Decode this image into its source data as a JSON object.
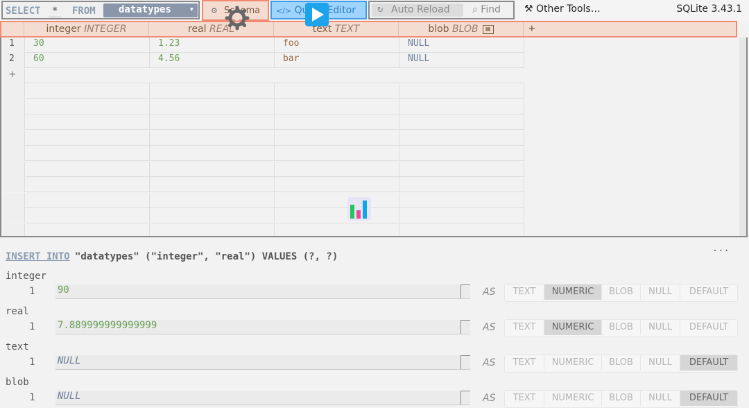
{
  "toolbar": {
    "select_kw": "SELECT",
    "star": "*",
    "from_kw": "FROM",
    "table_value": "datatypes",
    "schema_label": "Schema",
    "query_editor_label": "Query Editor",
    "auto_reload_label": "Auto Reload",
    "find_label": "Find",
    "other_tools_label": "Other Tools…",
    "version": "SQLite 3.43.1"
  },
  "columns": [
    {
      "name": "integer",
      "type": "INTEGER"
    },
    {
      "name": "real",
      "type": "REAL"
    },
    {
      "name": "text",
      "type": "TEXT"
    },
    {
      "name": "blob",
      "type": "BLOB"
    }
  ],
  "add_column_label": "+",
  "rows": [
    {
      "n": "1",
      "integer": "30",
      "real": "1.23",
      "text": "foo",
      "blob": "NULL"
    },
    {
      "n": "2",
      "integer": "60",
      "real": "4.56",
      "text": "bar",
      "blob": "NULL"
    }
  ],
  "add_row_label": "+",
  "insert": {
    "keyword": "INSERT INTO",
    "statement": "\"datatypes\" (\"integer\", \"real\") VALUES (?, ?)",
    "more": "···",
    "as_label": "AS",
    "type_options": [
      "TEXT",
      "NUMERIC",
      "BLOB",
      "NULL",
      "DEFAULT"
    ],
    "fields": [
      {
        "name": "integer",
        "line": "1",
        "value": "90",
        "selected": "NUMERIC"
      },
      {
        "name": "real",
        "line": "1",
        "value": "7.889999999999999",
        "selected": "NUMERIC"
      },
      {
        "name": "text",
        "line": "1",
        "value": "NULL",
        "selected": "DEFAULT"
      },
      {
        "name": "blob",
        "line": "1",
        "value": "NULL",
        "selected": "DEFAULT"
      }
    ]
  },
  "colors": {
    "accent_header": "#f08a73",
    "query_tab": "#3f9de8",
    "play_button": "#1ca3ec",
    "number_value": "#6a9f55",
    "string_value": "#9a6a45",
    "null_value": "#6f7f9a"
  },
  "icons": [
    "gear-icon",
    "code-icon",
    "play-icon",
    "reload-icon",
    "search-icon",
    "tools-icon",
    "blob-icon",
    "chart-icon",
    "chevron-down-icon"
  ]
}
